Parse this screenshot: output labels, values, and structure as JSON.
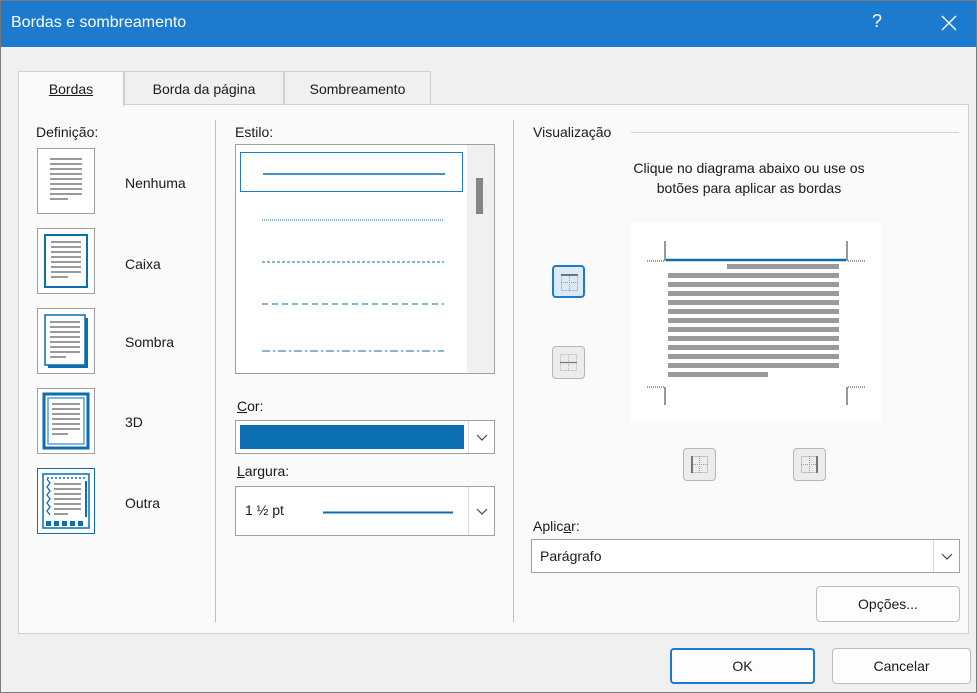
{
  "window": {
    "title": "Bordas e sombreamento",
    "help": "?",
    "accent": "#1c7bcf"
  },
  "tabs": [
    {
      "label": "Bordas",
      "active": true
    },
    {
      "label": "Borda da página",
      "active": false
    },
    {
      "label": "Sombreamento",
      "active": false
    }
  ],
  "definicao": {
    "label": "Definição:",
    "items": [
      {
        "label": "Nenhuma",
        "icon": "setting-none-icon"
      },
      {
        "label": "Caixa",
        "icon": "setting-box-icon"
      },
      {
        "label": "Sombra",
        "icon": "setting-shadow-icon"
      },
      {
        "label": "3D",
        "icon": "setting-3d-icon"
      },
      {
        "label": "Outra",
        "icon": "setting-custom-icon"
      }
    ]
  },
  "estilo": {
    "label": "Estilo:",
    "styles": [
      "solid",
      "dotted",
      "dashed-small",
      "dashed",
      "dash-dot"
    ],
    "selected": "solid"
  },
  "cor": {
    "label": "Cor:",
    "value": "#0a6eb0"
  },
  "largura": {
    "label": "Largura:",
    "value": "1 ½ pt"
  },
  "visualizacao": {
    "label": "Visualização",
    "instruction_line1": "Clique no diagrama abaixo ou use os",
    "instruction_line2": "botões para aplicar as bordas"
  },
  "aplicar": {
    "label": "Aplicar:",
    "value": "Parágrafo"
  },
  "buttons": {
    "options": "Opções...",
    "ok": "OK",
    "cancel": "Cancelar"
  }
}
